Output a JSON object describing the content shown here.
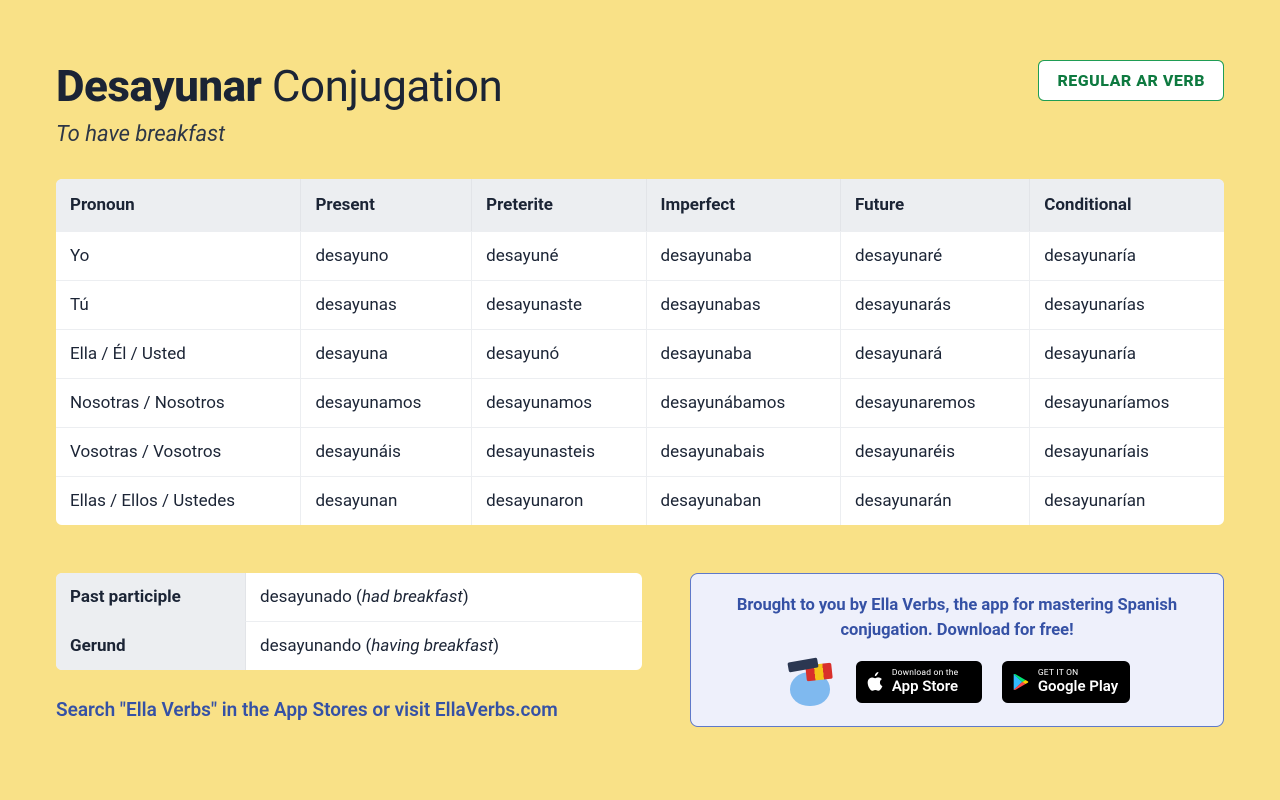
{
  "header": {
    "verb": "Desayunar",
    "suffix": "Conjugation",
    "subtitle": "To have breakfast",
    "badge": "REGULAR AR VERB"
  },
  "table": {
    "headers": [
      "Pronoun",
      "Present",
      "Preterite",
      "Imperfect",
      "Future",
      "Conditional"
    ],
    "rows": [
      [
        "Yo",
        "desayuno",
        "desayuné",
        "desayunaba",
        "desayunaré",
        "desayunaría"
      ],
      [
        "Tú",
        "desayunas",
        "desayunaste",
        "desayunabas",
        "desayunarás",
        "desayunarías"
      ],
      [
        "Ella / Él / Usted",
        "desayuna",
        "desayunó",
        "desayunaba",
        "desayunará",
        "desayunaría"
      ],
      [
        "Nosotras / Nosotros",
        "desayunamos",
        "desayunamos",
        "desayunábamos",
        "desayunaremos",
        "desayunaríamos"
      ],
      [
        "Vosotras / Vosotros",
        "desayunáis",
        "desayunasteis",
        "desayunabais",
        "desayunaréis",
        "desayunaríais"
      ],
      [
        "Ellas / Ellos / Ustedes",
        "desayunan",
        "desayunaron",
        "desayunaban",
        "desayunarán",
        "desayunarían"
      ]
    ]
  },
  "forms": {
    "past_participle_label": "Past participle",
    "past_participle_value": "desayunado",
    "past_participle_gloss": "had breakfast",
    "gerund_label": "Gerund",
    "gerund_value": "desayunando",
    "gerund_gloss": "having breakfast"
  },
  "search_line": "Search \"Ella Verbs\" in the App Stores or visit EllaVerbs.com",
  "promo": {
    "text": "Brought to you by Ella Verbs, the app for mastering Spanish conjugation. Download for free!",
    "appstore_small": "Download on the",
    "appstore_big": "App Store",
    "play_small": "GET IT ON",
    "play_big": "Google Play"
  }
}
